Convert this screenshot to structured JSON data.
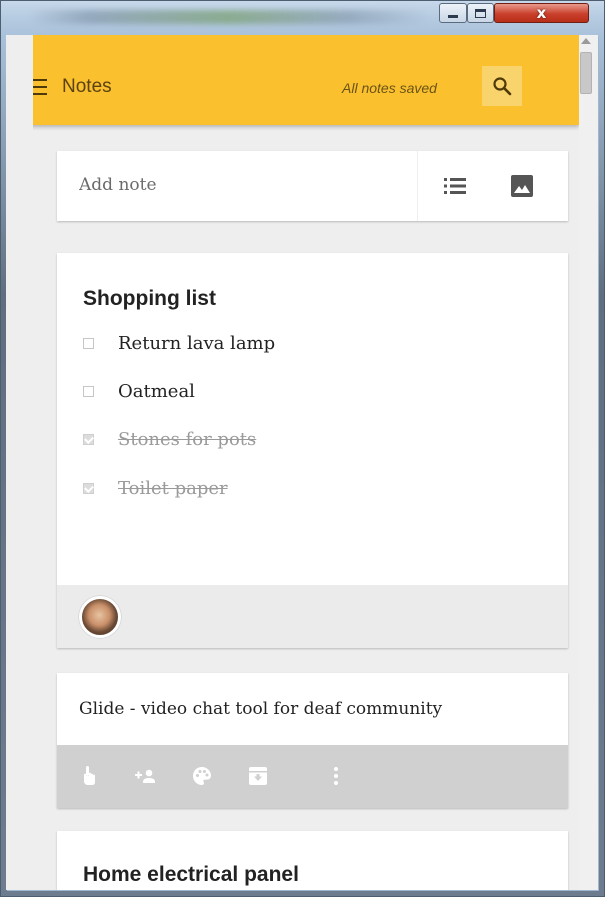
{
  "window": {
    "minimize_glyph": "",
    "maximize_glyph": "",
    "close_glyph": "x"
  },
  "header": {
    "title": "Notes",
    "save_status": "All notes saved",
    "menu_icon": "hamburger-menu-icon",
    "search_icon": "search-icon",
    "bar_color": "#fbc02d"
  },
  "add_note": {
    "placeholder": "Add note",
    "list_icon": "list-icon",
    "image_icon": "image-icon"
  },
  "notes": [
    {
      "title": "Shopping list",
      "items": [
        {
          "label": "Return lava lamp",
          "checked": false
        },
        {
          "label": "Oatmeal",
          "checked": false
        },
        {
          "label": "Stones for pots",
          "checked": true
        },
        {
          "label": "Toilet paper",
          "checked": true
        }
      ],
      "collaborator_icon": "avatar"
    },
    {
      "text": "Glide - video chat tool for deaf community",
      "toolbar_icons": [
        "reminder-hand-icon",
        "add-collaborator-icon",
        "palette-icon",
        "archive-icon",
        "more-vert-icon"
      ]
    },
    {
      "title": "Home electrical panel"
    }
  ]
}
